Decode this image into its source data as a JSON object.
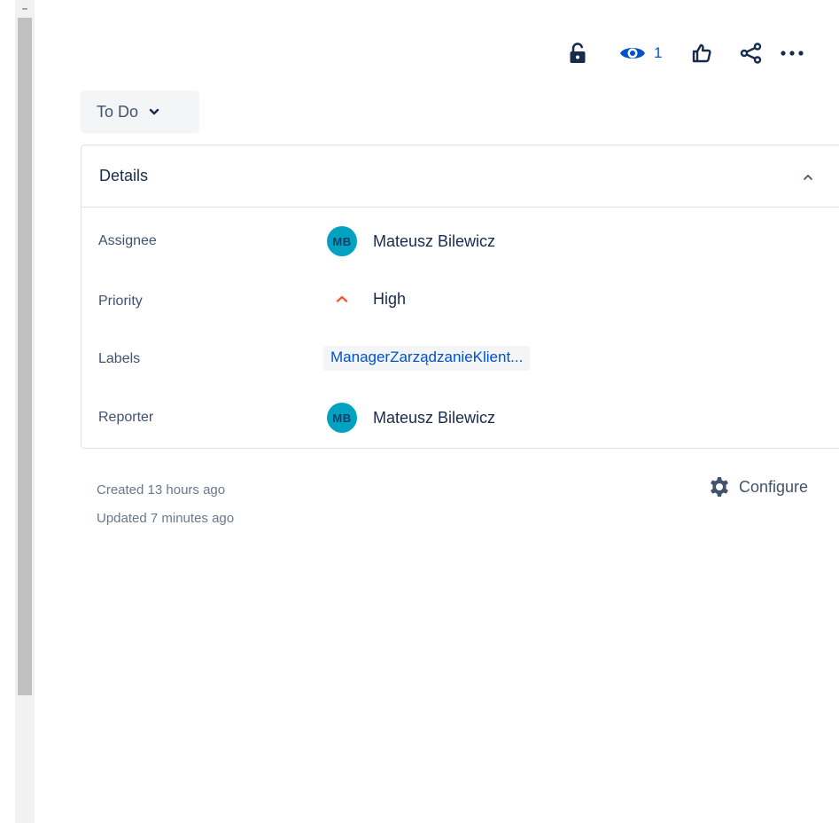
{
  "toolbar": {
    "watch_count": "1"
  },
  "status": {
    "label": "To Do"
  },
  "details": {
    "title": "Details",
    "fields": {
      "assignee": {
        "label": "Assignee",
        "initials": "MB",
        "name": "Mateusz Bilewicz"
      },
      "priority": {
        "label": "Priority",
        "value": "High",
        "color": "#ff5630"
      },
      "labels": {
        "label": "Labels",
        "value": "ManagerZarządzanieKlient..."
      },
      "reporter": {
        "label": "Reporter",
        "initials": "MB",
        "name": "Mateusz Bilewicz"
      }
    }
  },
  "meta": {
    "created": "Created 13 hours ago",
    "updated": "Updated 7 minutes ago"
  },
  "configure": {
    "label": "Configure"
  },
  "icons": {
    "lock": "unlock-icon",
    "watch": "eye-icon",
    "like": "thumbs-up-icon",
    "share": "share-icon",
    "more": "more-icon",
    "gear": "gear-icon"
  },
  "colors": {
    "brand_blue": "#0052cc",
    "avatar_bg": "#00a3bf",
    "priority_high": "#ff5630"
  }
}
